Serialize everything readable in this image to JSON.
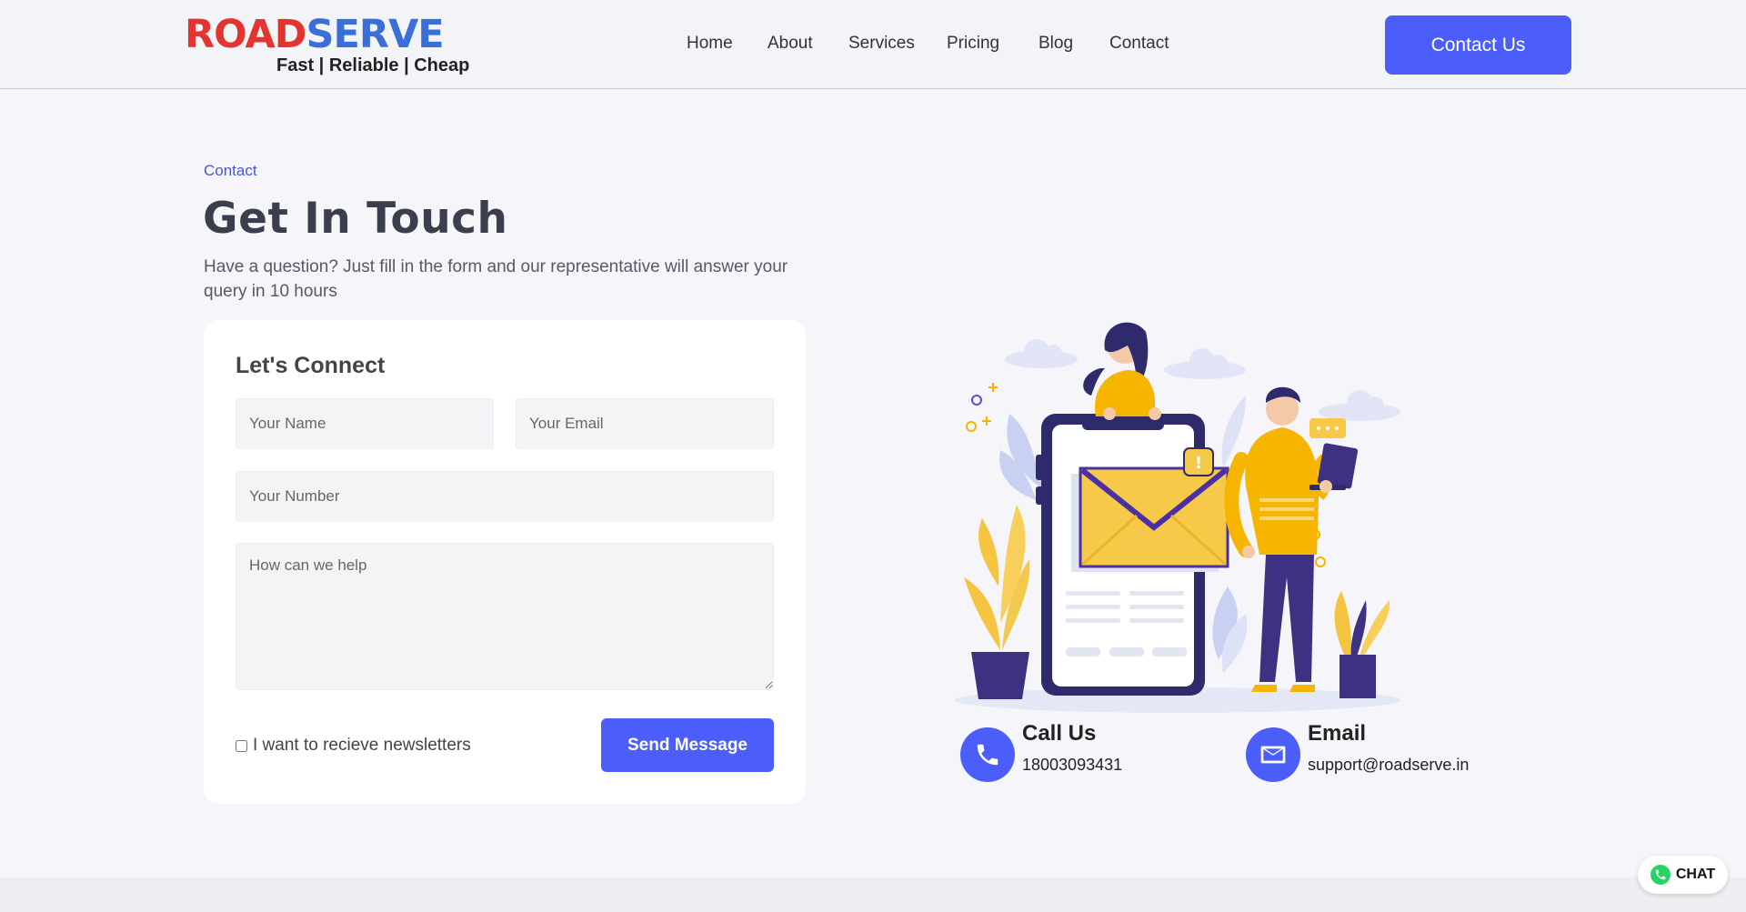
{
  "header": {
    "logo": {
      "word_part1": "ROAD",
      "word_part2": "SERVE",
      "tagline": "Fast | Reliable | Cheap"
    },
    "nav": [
      "Home",
      "About",
      "Services",
      "Pricing",
      "Blog",
      "Contact"
    ],
    "cta_label": "Contact Us"
  },
  "hero": {
    "eyebrow": "Contact",
    "title": "Get In Touch",
    "subtitle": "Have a question? Just fill in the form and our representative will answer your query in 10 hours"
  },
  "form": {
    "title": "Let's Connect",
    "name_placeholder": "Your Name",
    "email_placeholder": "Your Email",
    "number_placeholder": "Your Number",
    "help_placeholder": "How can we help",
    "newsletter_label": "I want to recieve newsletters",
    "newsletter_checked": false,
    "submit_label": "Send Message"
  },
  "contact_info": {
    "call": {
      "title": "Call Us",
      "value": "18003093431",
      "icon": "phone-icon"
    },
    "email": {
      "title": "Email",
      "value": "support@roadserve.in",
      "icon": "mail-icon"
    }
  },
  "chat": {
    "label": "CHAT",
    "icon": "whatsapp-icon"
  },
  "colors": {
    "accent": "#4b5ef9",
    "logo_red": "#e3342f",
    "logo_blue": "#3b6fd8",
    "illustration_yellow": "#f5b500",
    "illustration_navy": "#2e2a6b"
  }
}
